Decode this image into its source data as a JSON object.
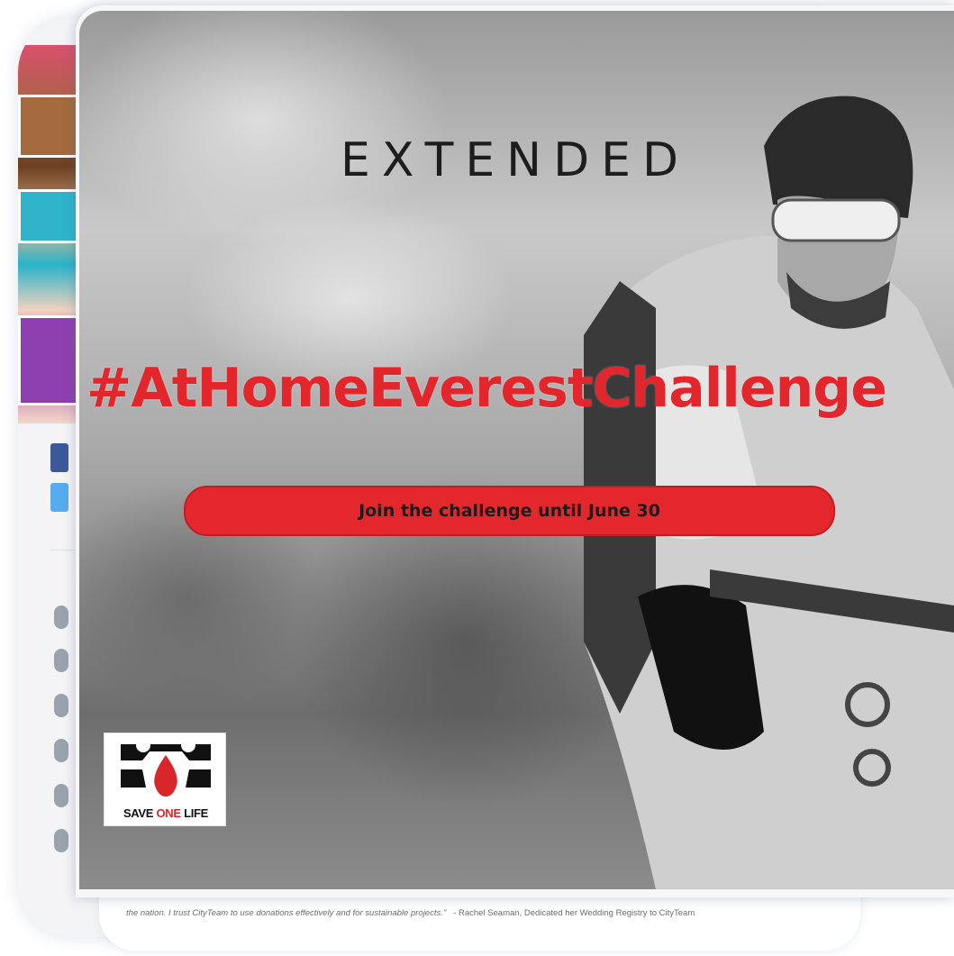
{
  "background_page": {
    "quote": "the nation. I trust CityTeam to use donations effectively and for sustainable projects.\"",
    "attribution": "- Rachel Seaman, Dedicated her Wedding Registry to CityTeam"
  },
  "poster": {
    "headline": "EXTENDED",
    "hashtag": "#AtHomeEverestChallenge",
    "cta_label": "Join the challenge until June 30",
    "logo": {
      "word1": "SAVE",
      "word2": "ONE",
      "word3": "LIFE"
    }
  },
  "colors": {
    "accent_red": "#e2262b",
    "text_dark": "#1d1d1d",
    "facebook_blue": "#3b5998",
    "twitter_blue": "#55acee"
  },
  "icons": [
    "facebook-icon",
    "twitter-icon",
    "save-one-life-logo"
  ]
}
